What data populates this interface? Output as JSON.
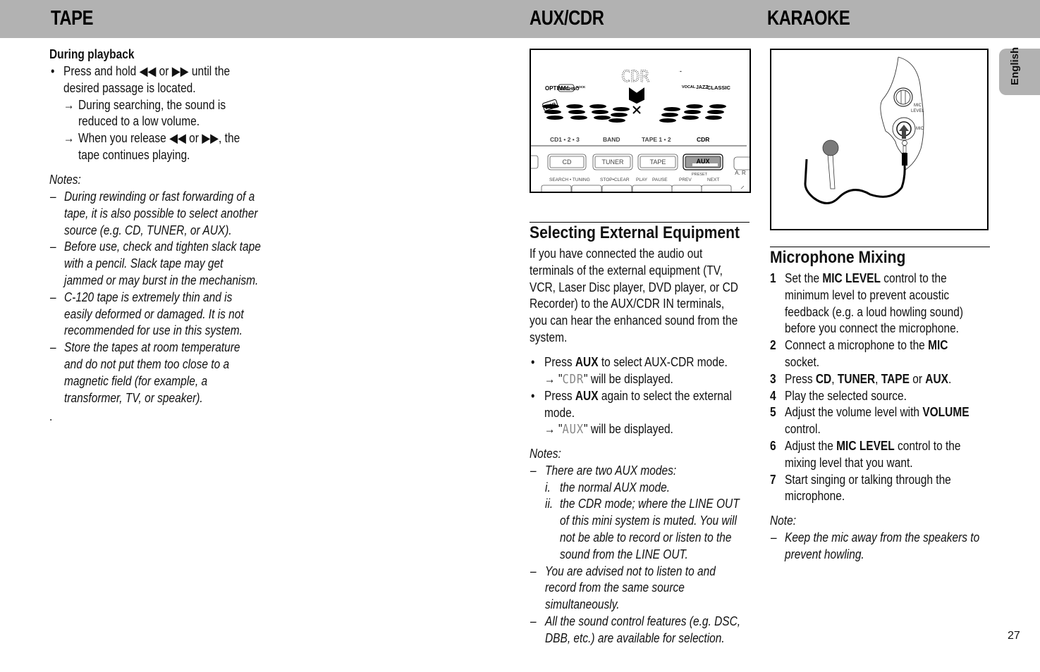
{
  "header": {
    "sections": [
      "TAPE",
      "AUX/CDR",
      "KARAOKE"
    ]
  },
  "language_tab": "English",
  "page_number": "27",
  "tape": {
    "subheading": "During playback",
    "bullet": {
      "lines": [
        "Press and hold ◀◀ or ▶▶ until the",
        "desired passage is located."
      ],
      "results": [
        [
          "During searching, the sound is",
          "reduced to a low volume."
        ],
        [
          "When you release ◀◀ or ▶▶, the",
          "tape continues playing."
        ]
      ]
    },
    "notes_label": "Notes:",
    "notes": [
      [
        "During rewinding or fast forwarding of a",
        "tape, it is also possible to select another",
        "source (e.g. CD, TUNER, or AUX)."
      ],
      [
        "Before use, check and tighten slack tape",
        "with a pencil.  Slack tape may get",
        "jammed or may burst in the mechanism."
      ],
      [
        "C-120 tape is extremely thin and is",
        "easily deformed or damaged.  It is not",
        "recommended for use in this system."
      ],
      [
        "Store the tapes at room temperature",
        "and do not put them too close to a",
        "magnetic field (for example, a",
        "transformer, TV, or speaker)."
      ]
    ],
    "trailing_dot": "."
  },
  "aux_figure": {
    "display_text": "CDR",
    "eq_left": [
      "OPTIMAL",
      "TECHNO",
      "ROCK"
    ],
    "eq_right": [
      "VOCAL",
      "JAZZ",
      "CLASSIC"
    ],
    "dbb_label": "DBB",
    "source_labels": [
      "CD1 • 2 • 3",
      "BAND",
      "TAPE 1 • 2",
      "CDR"
    ],
    "buttons": [
      "CD",
      "TUNER",
      "TAPE",
      "AUX"
    ],
    "right_label": "A. R",
    "preset_label": "PRESET",
    "bottom_labels": [
      "SEARCH • TUNING",
      "STOP•CLEAR",
      "PLAY",
      "PAUSE",
      "PREV",
      "NEXT"
    ]
  },
  "aux": {
    "heading": "Selecting External Equipment",
    "intro": [
      "If you have connected the audio out",
      "terminals of the external equipment (TV,",
      "VCR, Laser Disc player, DVD player, or CD",
      "Recorder) to the AUX/CDR IN terminals,",
      "you can hear the enhanced sound from the",
      "system."
    ],
    "steps": [
      {
        "pre": "Press ",
        "bold": "AUX",
        "post": " to select AUX-CDR mode.",
        "result_pre": "\"",
        "result_lcd": "CDR",
        "result_post": "\" will be displayed."
      },
      {
        "pre": "Press ",
        "bold": "AUX",
        "post": " again to select the external",
        "line2": "mode.",
        "result_pre": "\"",
        "result_lcd": "AUX",
        "result_post": "\" will be displayed."
      }
    ],
    "notes_label": "Notes:",
    "note1": "There are two AUX modes:",
    "note1_items": [
      {
        "num": "i.",
        "lines": [
          "the normal AUX mode."
        ]
      },
      {
        "num": "ii.",
        "lines": [
          "the CDR mode; where the LINE OUT",
          "of this mini system is muted. You will",
          "not be able to record or listen to the",
          "sound from the LINE OUT."
        ]
      }
    ],
    "note2": [
      "You are advised not to listen to and",
      "record from the same source",
      "simultaneously."
    ],
    "note3": [
      "All the sound control features (e.g. DSC,",
      "DBB, etc.) are available for selection."
    ]
  },
  "karaoke_figure": {
    "mic_level_label": [
      "MIC",
      "LEVEL"
    ],
    "mic_label": "MIC"
  },
  "karaoke": {
    "heading": "Microphone Mixing",
    "steps": [
      {
        "n": "1",
        "parts": [
          [
            "Set the ",
            "MIC LEVEL",
            " control to the"
          ],
          [
            "minimum level to prevent acoustic"
          ],
          [
            "feedback (e.g. a loud howling sound)"
          ],
          [
            "before you connect the microphone."
          ]
        ]
      },
      {
        "n": "2",
        "parts": [
          [
            "Connect a microphone to the ",
            "MIC",
            ""
          ],
          [
            "socket."
          ]
        ]
      },
      {
        "n": "3",
        "parts": [
          [
            "Press ",
            "CD",
            ", ",
            "TUNER",
            ", ",
            "TAPE",
            " or ",
            "AUX",
            "."
          ]
        ]
      },
      {
        "n": "4",
        "parts": [
          [
            "Play the selected source."
          ]
        ]
      },
      {
        "n": "5",
        "parts": [
          [
            "Adjust the volume level with ",
            "VOLUME",
            ""
          ],
          [
            "control."
          ]
        ]
      },
      {
        "n": "6",
        "parts": [
          [
            "Adjust the ",
            "MIC LEVEL",
            " control to the"
          ],
          [
            "mixing level that you want."
          ]
        ]
      },
      {
        "n": "7",
        "parts": [
          [
            "Start singing or talking through the"
          ],
          [
            "microphone."
          ]
        ]
      }
    ],
    "note_label": "Note:",
    "note": [
      "Keep the mic away from the speakers to",
      "prevent howling."
    ]
  }
}
